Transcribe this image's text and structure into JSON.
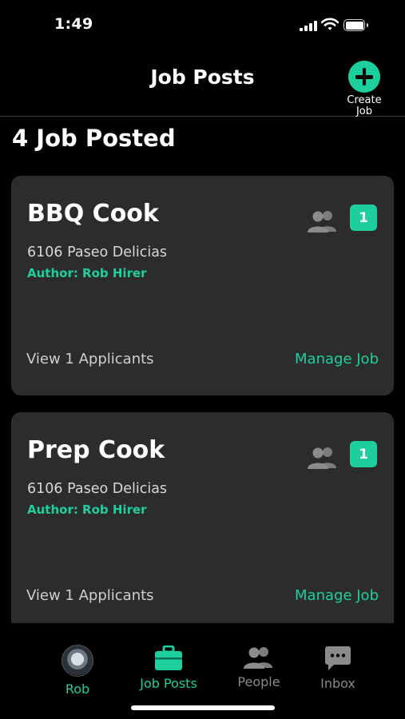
{
  "status_bar": {
    "time": "1:49"
  },
  "header": {
    "title": "Job Posts",
    "create_label": "Create Job"
  },
  "jobs_count_label": "4 Job Posted",
  "jobs": [
    {
      "title": "BBQ Cook",
      "address": "6106 Paseo Delicias",
      "author": "Author: Rob Hirer",
      "applicant_count": "1",
      "view_applicants": "View 1 Applicants",
      "manage": "Manage Job"
    },
    {
      "title": "Prep Cook",
      "address": "6106 Paseo Delicias",
      "author": "Author: Rob Hirer",
      "applicant_count": "1",
      "view_applicants": "View 1 Applicants",
      "manage": "Manage Job"
    }
  ],
  "nav": [
    {
      "label": "Rob",
      "icon": "avatar",
      "active": true
    },
    {
      "label": "Job Posts",
      "icon": "briefcase-icon",
      "active": true
    },
    {
      "label": "People",
      "icon": "people-icon",
      "active": false
    },
    {
      "label": "Inbox",
      "icon": "chat-icon",
      "active": false
    }
  ],
  "colors": {
    "accent": "#1ccf9d",
    "card": "#2c2c2c",
    "background": "#000000"
  }
}
